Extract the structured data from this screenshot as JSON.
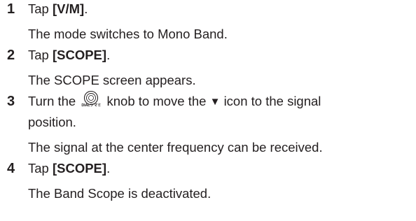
{
  "steps": [
    {
      "number": "1",
      "action_prefix": "Tap ",
      "action_key": "[V/M]",
      "action_suffix": ".",
      "result": "The mode switches to Mono Band."
    },
    {
      "number": "2",
      "action_prefix": "Tap ",
      "action_key": "[SCOPE]",
      "action_suffix": ".",
      "result": "The SCOPE screen appears."
    },
    {
      "number": "3",
      "action_part1": "Turn the",
      "dial_icon": "dial-knob-icon",
      "dial_label": "DIALツマミ",
      "action_part2": "knob to move the",
      "triangle_glyph": "▼",
      "action_part3": "icon to the signal",
      "action_line2": "position.",
      "result": "The signal at the center frequency can be received."
    },
    {
      "number": "4",
      "action_prefix": "Tap ",
      "action_key": "[SCOPE]",
      "action_suffix": ".",
      "result": "The Band Scope is deactivated."
    }
  ]
}
